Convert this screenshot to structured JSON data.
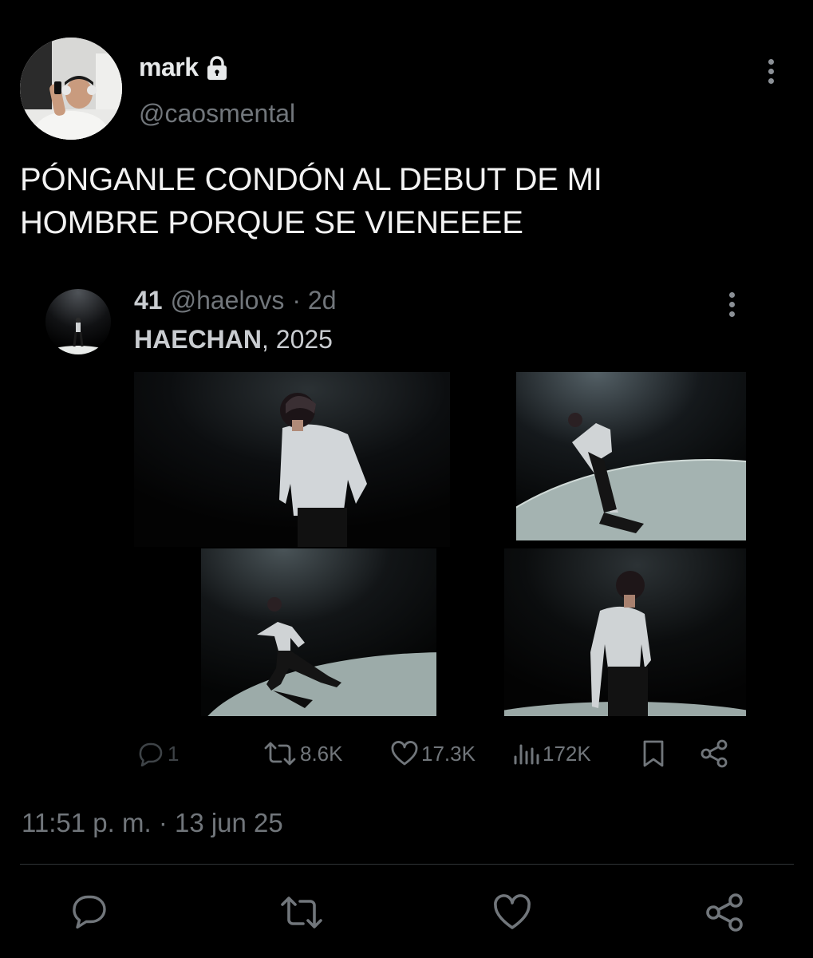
{
  "author": {
    "display_name": "mark",
    "handle": "@caosmental",
    "verified_lock": "lock-icon"
  },
  "tweet": {
    "text": "PÓNGANLE CONDÓN AL DEBUT DE MI\nHOMBRE PORQUE SE VIENEEEE",
    "timestamp": "11:51 p. m. · 13 jun 25"
  },
  "quoted": {
    "name": "41",
    "handle": "@haelovs",
    "age": "· 2d",
    "text_bold": "HAECHAN",
    "text_rest": ", 2025",
    "stats": {
      "replies": "1",
      "retweets": "8.6K",
      "likes": "17.3K",
      "views": "172K"
    }
  },
  "icons": {
    "reply": "reply-icon",
    "retweet": "retweet-icon",
    "like": "heart-icon",
    "views": "views-icon",
    "bookmark": "bookmark-icon",
    "share": "share-icon",
    "more": "more-vertical-icon"
  },
  "colors": {
    "background": "#000000",
    "text_primary": "#e7e9ea",
    "text_secondary": "#71767b",
    "divider": "#2f3336"
  }
}
